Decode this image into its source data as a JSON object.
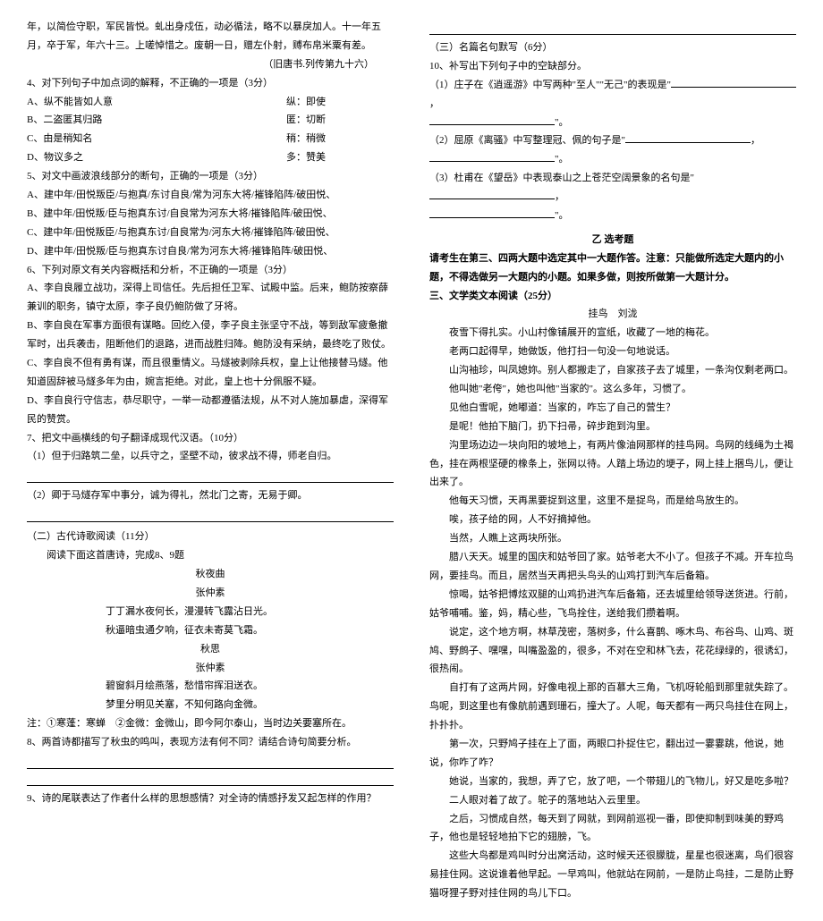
{
  "left": {
    "p1": "年，以简俭守职，军民皆悦。虬出身戍伍，动必循法，略不以暴戾加人。十一年五月，卒于军，年六十三。上嗟悼惜之。废朝一日，赠左仆射，赙布帛米粟有差。",
    "src": "（旧唐书.列传第九十六）",
    "q4": "4、对下列句子中加点词的解释，不正确的一项是（3分）",
    "q4a_l": "A、纵不能皆如人意",
    "q4a_r": "纵：即使",
    "q4b_l": "B、二盗匿其归路",
    "q4b_r": "匿：切断",
    "q4c_l": "C、由是稍知名",
    "q4c_r": "稍：稍微",
    "q4d_l": "D、物议多之",
    "q4d_r": "多：赞美",
    "q5": "5、对文中画波浪线部分的断句，正确的一项是（3分）",
    "q5a": "A、建中年/田悦叛臣/与抱真/东讨自良/常为河东大将/摧锋陷阵/破田悦、",
    "q5b": "B、建中年/田悦叛/臣与抱真东讨/自良常为河东大将/摧锋陷阵/破田悦、",
    "q5c": "C、建中年/田悦叛臣/与抱真东讨/自良常为/河东大将/摧锋陷阵/破田悦、",
    "q5d": "D、建中年/田悦叛/臣与抱真东讨自良/常为河东大将/摧锋陷阵/破田悦、",
    "q6": "6、下列对原文有关内容概括和分析，不正确的一项是（3分）",
    "q6a": "A、李自良履立战功，深得上司信任。先后担任卫军、试殿中监。后来，鲍防按察薛兼训的职务，镇守太原，李子良仍鲍防做了牙将。",
    "q6b": "B、李自良在军事方面很有谋略。回纥入侵，李子良主张坚守不战，等到敌军疲惫撤军时，出兵袭击，阻断他们的退路，进而战胜归降。鲍防没有采纳，最终吃了败仗。",
    "q6c": "C、李自良不但有勇有谋，而且很重情义。马燧被剥除兵权，皇上让他接替马燧。他知道固辞被马燧多年为由，婉言拒绝。对此，皇上也十分佩服不疑。",
    "q6d": "D、李自良行守信志，恭尽职守，一举一动都遵循法规，从不对人施加暴虐，深得军民的赞赏。",
    "q7": "7、把文中画横线的句子翻译成现代汉语。（10分）",
    "q7_1": "（1）但于归路筑二垒，以兵守之，坚壁不动，彼求战不得，师老自归。",
    "q7_2": "（2）卿于马燧存军中事分，诚为得礼，然北门之寄，无易于卿。",
    "poem_head": "（二）古代诗歌阅读（11分）",
    "poem_sub": "阅读下面这首唐诗，完成8、9题",
    "poem_title": "秋夜曲",
    "poem_author": "张仲素",
    "poem_l1": "丁丁漏水夜何长，漫漫转飞露沾日光。",
    "poem_l2": "秋逼暗虫通夕响，征衣未寄莫飞霜。",
    "poem_title2": "秋思",
    "poem_author2": "张仲素",
    "poem_l3": "碧窗斜月绘燕落，愁惜帘挥泪送衣。",
    "poem_l4": "梦里分明见关塞，不知何路向金微。",
    "notes": "注：①寒蓬：寒蝉　②金微：金微山，即今阿尔泰山，当时边关要塞所在。",
    "q8": "8、两首诗都描写了秋虫的鸣叫，表现方法有何不同？请结合诗句简要分析。",
    "q9": "9、诗的尾联表达了作者什么样的思想感情？对全诗的情感抒发又起怎样的作用？"
  },
  "right": {
    "sec3": "（三）名篇名句默写（6分）",
    "q10": "10、补写出下列句子中的空缺部分。",
    "q10_1a": "（1）庄子在《逍遥游》中写两种\"至人\"\"无己\"的表现是\"",
    "q10_1b": "\"。",
    "q10_2a": "（2）屈原《离骚》中写整理冠、佩的句子是\"",
    "q10_2b": "\"。",
    "q10_3a": "（3）杜甫在《望岳》中表现泰山之上苍茫空阔景象的名句是\"",
    "q10_3b": "\"。",
    "zx_title": "乙 选考题",
    "zx_note": "请考生在第三、四两大题中选定其中一大题作答。注意：只能做所选定大题内的小题，不得选做另一大题内的小题。如果多做，则按所做第一大题计分。",
    "sec_lit": "三、文学类文本阅读（25分）",
    "story_title": "挂鸟",
    "story_author": "刘泷",
    "s1": "夜雪下得扎实。小山村像铺展开的宣纸，收藏了一地的梅花。",
    "s2": "老两口起得早，她做饭，他打扫一句没一句地说话。",
    "s3": "山沟袖珍，叫凤媳妳。别人都搬走了，自家孩子去了城里，一条沟仅剩老两口。",
    "s4": "他叫她\"老侉\"，她也叫他\"当家的\"。这么多年，习惯了。",
    "s5": "见他白雪呢，她嘟道：当家的，咋忘了自己的营生？",
    "s6": "是呢！他拍下脑门，扔下扫帚，碎步跑到沟里。",
    "s7": "沟里场边边一块向阳的坡地上，有两片像油网那样的挂鸟网。鸟网的线绳为土褐色，挂在两根坚硬的橡条上，张网以待。人踏上场边的埂子，网上挂上捆鸟儿，便让出来了。",
    "s8": "他每天习惯，天再黑要捉到这里，这里不是捉鸟，而是给鸟放生的。",
    "s9": "唉，孩子给的网，人不好摘掉他。",
    "s10": "当然，人瞧上这两块所张。",
    "s11": "腊八天天。城里的国庆和姑爷回了家。姑爷老大不小了。但孩子不减。开车拉鸟网，要挂鸟。而且，居然当天再把头鸟头的山鸡打到汽车后备箱。",
    "s12": "惊喝，姑爷把博炫双腿的山鸡扔进汽车后备箱，还去城里给领导送货进。行前，姑爷哺哺。鉴，妈，精心些，飞鸟拴住，送给我们攒着啊。",
    "s13": "说定，这个地方啊，林草茂密，落树多，什么喜鹊、啄木鸟、布谷鸟、山鸡、斑鸠、野鹧子、嘿嘿，叫嘴盈盈的，很多，不对在空和林飞去，花花绿绿的，很诱幻，很热闹。",
    "s14": "自打有了这两片网，好像电视上那的百慕大三角，飞机呀轮船到那里就失踪了。鸟呢，到这里也有像航前遇到珊石，撞大了。人呢，每天都有一两只鸟挂住在网上，扑扑扑。",
    "s15": "第一次，只野鸠子挂在上了面，两眼口扑捉住它，翻出过一霎霎跳，他说，她说，你咋了咋？",
    "s16": "她说，当家的，我想，弄了它，放了吧，一个带翅儿的飞物儿，好又是吃多啦？",
    "s17": "二人眼对着了故了。鸵子的落地站入云里里。",
    "s18": "之后，习惯成自然，每天到了网就，到网前巡视一番，即使抑制到味美的野鸡子，他也是轻轻地拍下它的翅膀，飞。",
    "s19": "这些大鸟都是鸡叫时分出窝活动，这时候天还很朦胧，星星也很迷离，鸟们很容易挂住网。这说谁着他早起。一早鸡叫，他就站在网前，一是防止鸟挂，二是防止野猫呀狸子野对挂住网的鸟儿下口。"
  }
}
